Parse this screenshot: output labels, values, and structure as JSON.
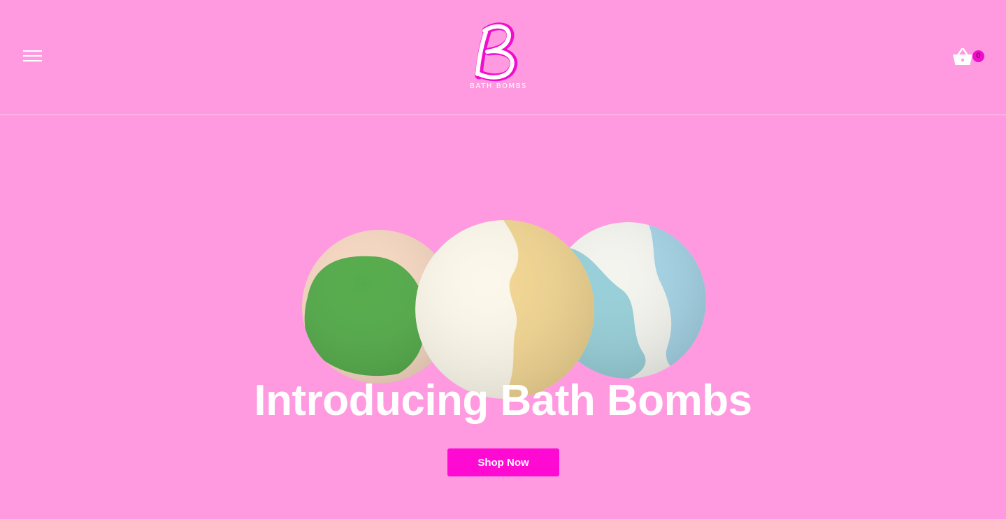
{
  "header": {
    "logo_text": "BATH BOMBS",
    "menu_icon": "hamburger-menu-icon",
    "cart_icon": "basket-icon",
    "cart_count": "0"
  },
  "hero": {
    "title": "Introducing Bath Bombs",
    "cta_label": "Shop Now",
    "image": "three-bath-bombs-image"
  },
  "colors": {
    "background": "#ff99e0",
    "accent": "#ff0ad3",
    "badge": "#f20ccc",
    "text": "#ffffff"
  }
}
